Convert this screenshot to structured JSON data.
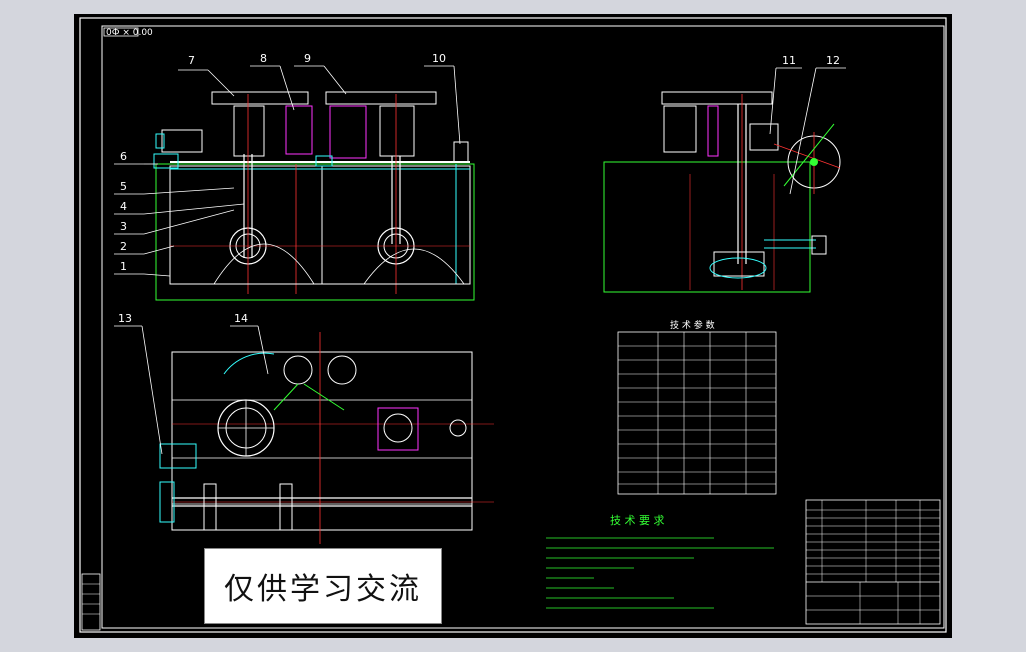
{
  "drawing": {
    "code_box": "0Ф × 0.00",
    "part_labels": [
      "1",
      "2",
      "3",
      "4",
      "5",
      "6",
      "7",
      "8",
      "9",
      "10",
      "11",
      "12",
      "13",
      "14"
    ],
    "tech_requirements_title": "技 术 要 求",
    "tech_params_title": "技 术 参 数",
    "watermark": "仅供学习交流"
  },
  "colors": {
    "background": "#000000",
    "outline": "#ffffff",
    "centerline": "#ff3333",
    "green": "#33ff33",
    "magenta": "#ff33ff",
    "cyan": "#33ffff",
    "yellow": "#ffff33",
    "blue": "#4477ff"
  }
}
